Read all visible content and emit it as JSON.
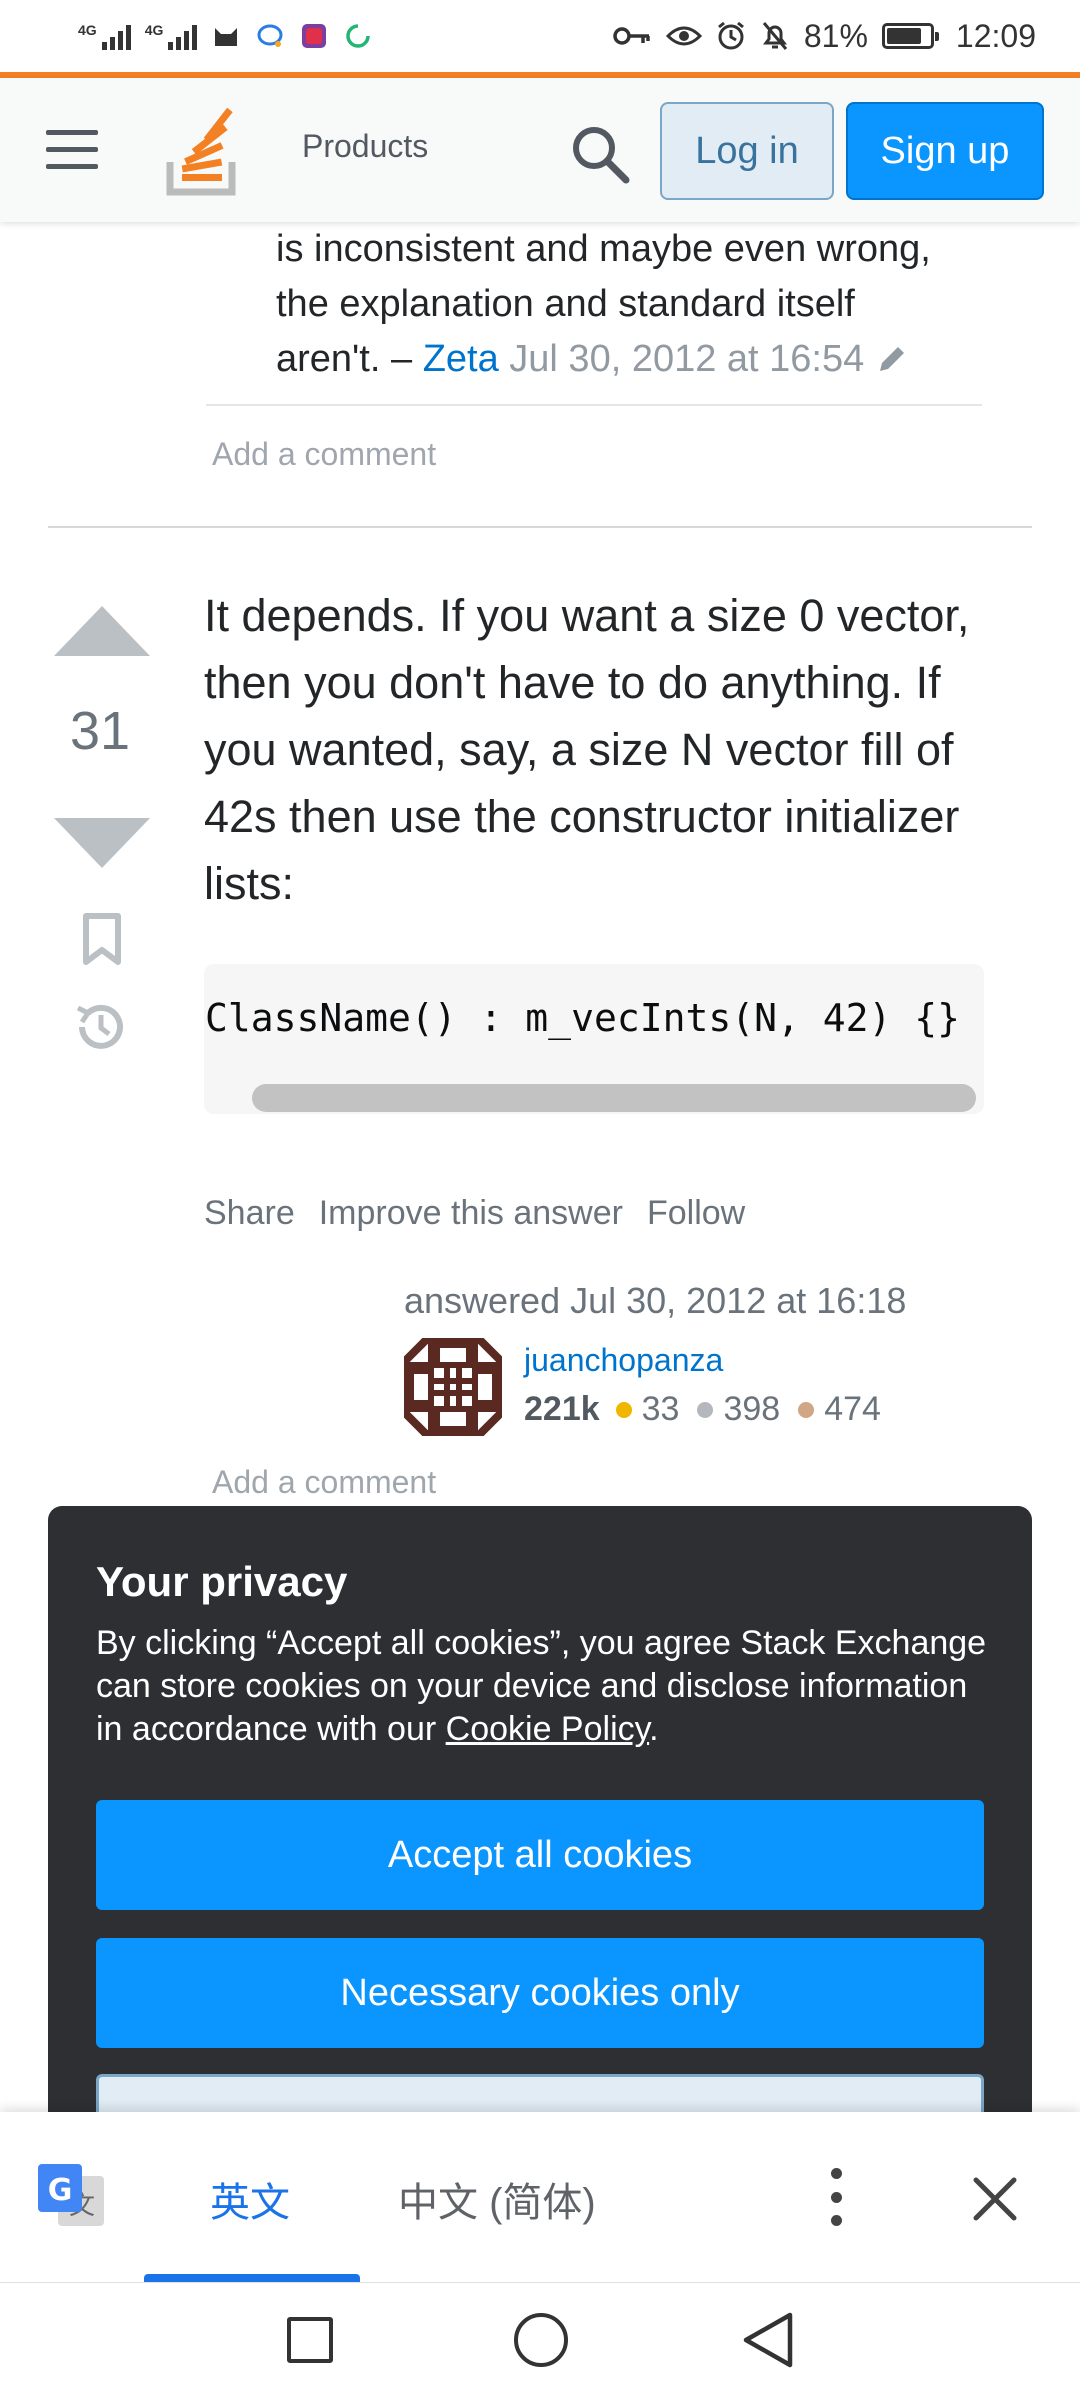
{
  "status_bar": {
    "net1": "4G",
    "net2": "4G",
    "battery_percent": "81%",
    "battery_level": 0.81,
    "time": "12:09",
    "icons": [
      "signal-icon",
      "signal-icon",
      "cat-app-icon",
      "chat-bubble-icon",
      "sticker-app-icon",
      "sync-icon",
      "key-icon",
      "eye-icon",
      "alarm-icon",
      "bell-off-icon",
      "battery-icon"
    ]
  },
  "header": {
    "products_label": "Products",
    "login_label": "Log in",
    "signup_label": "Sign up",
    "accent_color": "#f48024",
    "button_color": "#0a95ff"
  },
  "comment": {
    "text_line1": "is inconsistent and maybe even wrong,",
    "text_line2": "the explanation and standard itself",
    "text_line3": "aren't. – ",
    "user": "Zeta",
    "date": "Jul 30, 2012 at 16:54",
    "add_comment": "Add a comment"
  },
  "answer": {
    "votes": "31",
    "text": "It depends. If you want a size 0 vector, then you don't have to do anything. If you wanted, say, a size N vector fill of 42s then use the constructor initializer lists:",
    "code": "ClassName() : m_vecInts(N, 42) {}",
    "menu": {
      "share": "Share",
      "improve": "Improve this answer",
      "follow": "Follow"
    },
    "answered": "answered Jul 30, 2012 at 16:18",
    "user": {
      "name": "juanchopanza",
      "reputation": "221k",
      "gold": "33",
      "silver": "398",
      "bronze": "474",
      "gold_color": "#f1b600",
      "silver_color": "#b4b8bc",
      "bronze_color": "#d1a684"
    },
    "add_comment": "Add a comment"
  },
  "privacy": {
    "title": "Your privacy",
    "body_before": "By clicking “Accept all cookies”, you agree Stack Exchange can store cookies on your device and disclose information in accordance with our ",
    "link": "Cookie Policy",
    "body_after": ".",
    "accept_all": "Accept all cookies",
    "necessary_only": "Necessary cookies only"
  },
  "translate": {
    "source_lang": "英文",
    "target_lang": "中文 (简体)"
  }
}
